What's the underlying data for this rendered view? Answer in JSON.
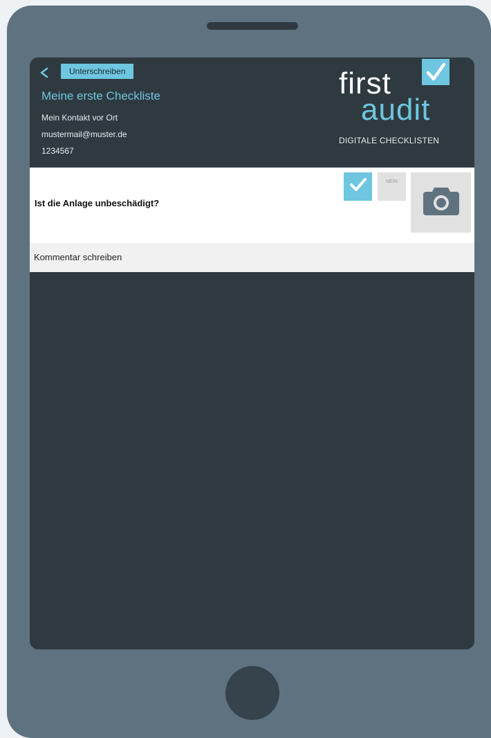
{
  "header": {
    "sign_button_label": "Unterschreiben",
    "checklist_title": "Meine erste Checkliste",
    "contact_name": "Mein Kontakt vor Ort",
    "contact_email": "mustermail@muster.de",
    "contact_phone": "1234567"
  },
  "logo": {
    "word_first": "first",
    "word_audit": "audit",
    "tagline": "DIGITALE CHECKLISTEN"
  },
  "question": {
    "text": "Ist die Anlage unbeschädigt?",
    "no_label": "NEIN"
  },
  "comment": {
    "placeholder": "Kommentar schreiben"
  },
  "icons": {
    "back": "chevron-left-icon",
    "yes": "checkmark-icon",
    "camera": "camera-icon",
    "logo_check": "checkmark-icon"
  },
  "colors": {
    "accent": "#6ec6e0",
    "device": "#5f7280",
    "screen": "#2f3a40"
  }
}
